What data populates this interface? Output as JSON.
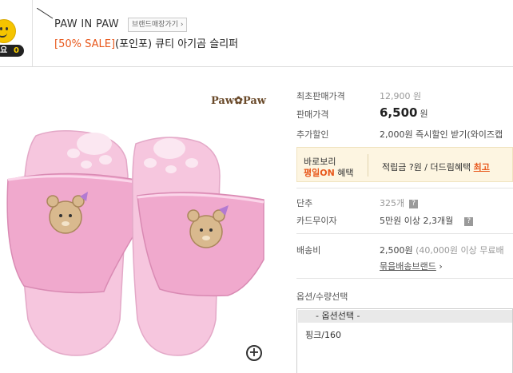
{
  "header": {
    "badge_text": "요",
    "badge_count": "0",
    "brand_name": "PAW IN PAW",
    "brand_button": "브랜드매장가기",
    "title_sale": "[50% SALE]",
    "title_rest": "(포인포) 큐티 아기곰 슬리퍼"
  },
  "image": {
    "logo": "Paw✿Paw",
    "zoom_icon": "zoom-plus-icon"
  },
  "info": {
    "original_price_label": "최초판매가격",
    "original_price": "12,900 원",
    "price_label": "판매가격",
    "price": "6,500",
    "price_unit": "원",
    "discount_label": "추가할인",
    "discount_text": "2,000원 즉시할인 받기(와이즈캡",
    "benefit_line1": "바로보리",
    "benefit_line2_hl": "평일ON",
    "benefit_line2_rest": " 혜택",
    "benefit_points": "적립금 ?원 / 더드림혜택 ",
    "benefit_link": "최고",
    "unit_label": "단추",
    "unit_value": "325개",
    "card_label": "카드무이자",
    "card_value": "5만원 이상 2,3개월",
    "shipping_label": "배송비",
    "shipping_value": "2,500원",
    "shipping_note": " (40,000원 이상 무료배",
    "bundle_link": "묶음배송브랜드",
    "options_label": "옵션/수량선택",
    "select_placeholder": "- 옵션선택 -",
    "option_value": "핑크/160"
  },
  "colors": {
    "accent_orange": "#e8581c",
    "benefit_bg": "#fdf5e1",
    "slipper_pink": "#f3b8d6"
  }
}
